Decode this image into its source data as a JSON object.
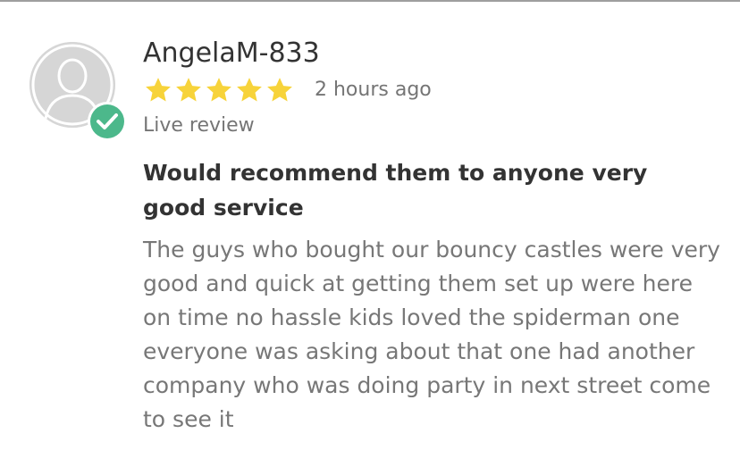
{
  "review": {
    "author": "AngelaM-833",
    "rating": 5,
    "rating_max": 5,
    "time_ago": "2 hours ago",
    "status": "Live review",
    "title": "Would recommend them to anyone very good service",
    "body": "The guys who bought our bouncy castles were very good and quick at getting them set up were here on time no hassle kids loved the spiderman one everyone was asking about that one had another company who was doing party in next street come to see it"
  },
  "icons": {
    "avatar": "person-silhouette-icon",
    "badge": "verified-check-icon",
    "star": "star-icon"
  },
  "colors": {
    "star": "#f7d33a",
    "badge": "#4cb88b",
    "avatar_bg": "#d6d6d6",
    "name_text": "#333333",
    "meta_text": "#757575",
    "body_text": "#777777"
  }
}
